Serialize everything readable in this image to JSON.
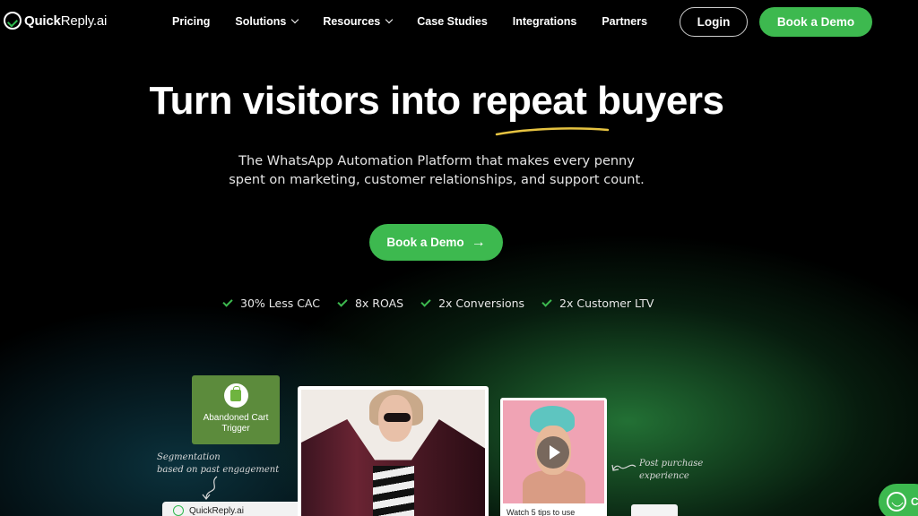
{
  "brand": {
    "name_bold": "Quick",
    "name_light": "Reply.ai"
  },
  "nav": {
    "links": [
      {
        "label": "Pricing",
        "dropdown": false
      },
      {
        "label": "Solutions",
        "dropdown": true
      },
      {
        "label": "Resources",
        "dropdown": true
      },
      {
        "label": "Case Studies",
        "dropdown": false
      },
      {
        "label": "Integrations",
        "dropdown": false
      },
      {
        "label": "Partners",
        "dropdown": false
      }
    ],
    "login_label": "Login",
    "demo_label": "Book a Demo"
  },
  "hero": {
    "title_before": "Turn visitors into ",
    "title_highlight": "repeat",
    "title_after": " buyers",
    "subtitle_line1": "The WhatsApp Automation Platform that makes every penny",
    "subtitle_line2": "spent on marketing, customer relationships, and support count.",
    "cta_label": "Book a Demo",
    "cta_icon": "arrow-right-icon"
  },
  "stats": [
    "30% Less CAC",
    "8x ROAS",
    "2x Conversions",
    "2x Customer LTV"
  ],
  "showcase": {
    "trigger_line1": "Abandoned Cart",
    "trigger_line2": "Trigger",
    "segmentation_line1": "Segmentation",
    "segmentation_line2": "based on past engagement",
    "wa_card_label": "QuickReply.ai",
    "video_caption": "Watch 5 tips to use",
    "post_purchase_line1": "Post purchase",
    "post_purchase_line2": "experience"
  },
  "floating": {
    "text": "C"
  },
  "colors": {
    "accent": "#3db94f",
    "background": "#000000",
    "highlight_underline": "#e6c341"
  }
}
